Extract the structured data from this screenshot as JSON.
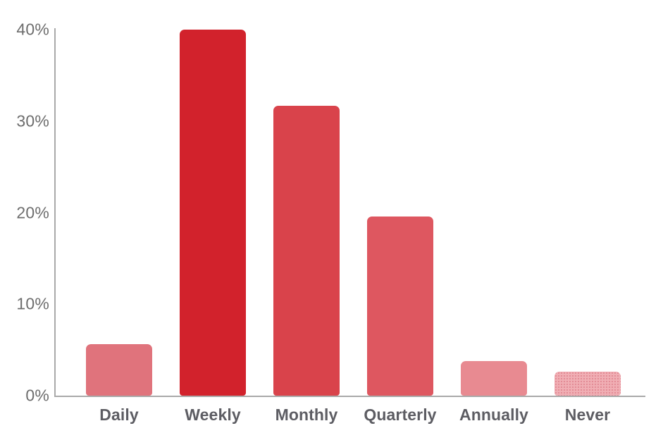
{
  "chart_data": {
    "type": "bar",
    "title": "",
    "subtitle": "",
    "xlabel": "",
    "ylabel": "",
    "categories": [
      "Daily",
      "Weekly",
      "Monthly",
      "Quarterly",
      "Annually",
      "Never"
    ],
    "values": [
      5.6,
      40.0,
      31.7,
      19.6,
      3.8,
      2.6
    ],
    "value_labels": [
      "",
      "",
      "",
      "",
      "",
      ""
    ],
    "ylim": [
      0,
      40
    ],
    "y_ticks": [
      0,
      10,
      20,
      30,
      40
    ],
    "y_tick_labels": [
      "0%",
      "10%",
      "20%",
      "30%",
      "40%"
    ],
    "grid": false,
    "legend": null,
    "bar_colors": [
      "#e0737c",
      "#d2222c",
      "#d9434b",
      "#de5760",
      "#e88a91",
      "#f0aeb4"
    ],
    "bar_textures": [
      "solid",
      "solid",
      "solid",
      "solid",
      "solid",
      "dotted"
    ],
    "axis_color": "#a9a9a9",
    "label_color": "#5d5d63",
    "tick_color": "#6d6d6d",
    "background_color": "#ffffff"
  }
}
